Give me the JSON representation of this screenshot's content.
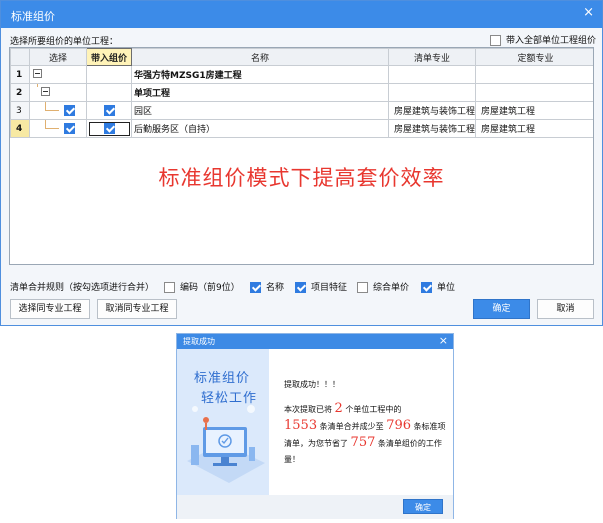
{
  "dialog": {
    "title": "标准组价",
    "close_icon": "×",
    "prompt": "选择所要组价的单位工程：",
    "bring_all_label": "带入全部单位工程组价",
    "bring_all_checked": false
  },
  "grid": {
    "columns": [
      "选择",
      "带入组价",
      "名称",
      "清单专业",
      "定额专业"
    ],
    "rows": [
      {
        "idx": "1",
        "name": "华强方特MZSG1房建工程",
        "select": null,
        "bring": null,
        "list_prof": "",
        "quota_prof": ""
      },
      {
        "idx": "2",
        "name": "单项工程",
        "select": null,
        "bring": null,
        "list_prof": "",
        "quota_prof": ""
      },
      {
        "idx": "3",
        "name": "园区",
        "select": true,
        "bring": true,
        "list_prof": "房屋建筑与装饰工程",
        "quota_prof": "房屋建筑工程"
      },
      {
        "idx": "4",
        "name": "后勤服务区（自持）",
        "select": true,
        "bring": true,
        "list_prof": "房屋建筑与装饰工程",
        "quota_prof": "房屋建筑工程"
      }
    ]
  },
  "slogan": "标准组价模式下提高套价效率",
  "merge": {
    "label": "清单合并规则（按勾选项进行合并）",
    "options": [
      {
        "label": "编码（前9位）",
        "checked": false
      },
      {
        "label": "名称",
        "checked": true
      },
      {
        "label": "项目特征",
        "checked": true
      },
      {
        "label": "综合单价",
        "checked": false
      },
      {
        "label": "单位",
        "checked": true
      }
    ]
  },
  "buttons": {
    "select_same": "选择同专业工程",
    "cancel_same": "取消同专业工程",
    "ok": "确定",
    "cancel": "取消"
  },
  "popup": {
    "title": "提取成功",
    "close_icon": "×",
    "art_line1": "标准组价",
    "art_line2": "轻松工作",
    "success": "提取成功！！！",
    "t1": "本次提取已将",
    "units": "2",
    "t2": "个单位工程中的",
    "before": "1553",
    "t3": "条清单合并成少至",
    "after": "796",
    "t4": "条标准项清单，为您节省了",
    "saved": "757",
    "t5": "条清单组价的工作量！",
    "ok": "确定"
  },
  "colors": {
    "title_bar": "#3c8be8",
    "accent_red": "#e8372f",
    "checkbox_blue": "#2f7be0"
  }
}
